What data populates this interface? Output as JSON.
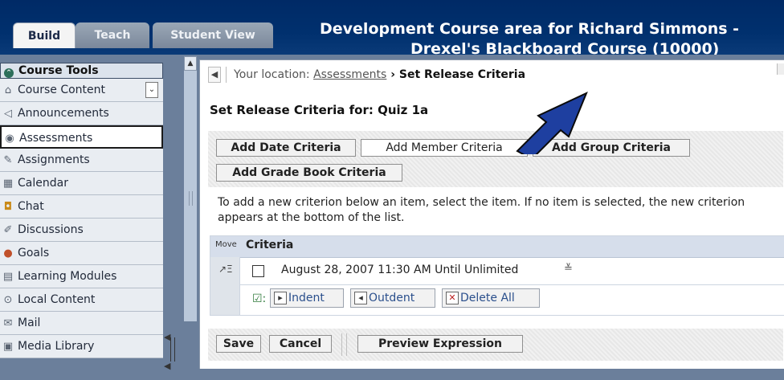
{
  "tabs": [
    {
      "label": "Build",
      "active": true
    },
    {
      "label": "Teach",
      "active": false
    },
    {
      "label": "Student View",
      "active": false
    }
  ],
  "course_title_line1": "Development Course area for Richard Simmons -",
  "course_title_line2": "Drexel's Blackboard Course (10000)",
  "sidebar": {
    "header": "Course Tools",
    "items": [
      {
        "label": "Course Content",
        "icon": "home-icon"
      },
      {
        "label": "Announcements",
        "icon": "megaphone-icon"
      },
      {
        "label": "Assessments",
        "icon": "assessment-icon",
        "active": true
      },
      {
        "label": "Assignments",
        "icon": "assignment-icon"
      },
      {
        "label": "Calendar",
        "icon": "calendar-icon"
      },
      {
        "label": "Chat",
        "icon": "chat-icon"
      },
      {
        "label": "Discussions",
        "icon": "discussion-icon"
      },
      {
        "label": "Goals",
        "icon": "goals-icon"
      },
      {
        "label": "Learning Modules",
        "icon": "learning-modules-icon"
      },
      {
        "label": "Local Content",
        "icon": "local-content-icon"
      },
      {
        "label": "Mail",
        "icon": "mail-icon"
      },
      {
        "label": "Media Library",
        "icon": "media-library-icon"
      }
    ]
  },
  "breadcrumb": {
    "prefix": "Your location: ",
    "link": "Assessments",
    "separator": " › ",
    "current": "Set Release Criteria"
  },
  "page_title": "Set Release Criteria for: Quiz 1a",
  "criteria_buttons": {
    "date": "Add Date Criteria",
    "member": "Add Member Criteria",
    "group": "Add Group Criteria",
    "gradebook": "Add Grade Book Criteria"
  },
  "hint": "To add a new criterion below an item, select the item. If no item is selected, the new criterion appears at the bottom of the list.",
  "criteria_table": {
    "move_header": "Move",
    "criteria_header": "Criteria",
    "rows": [
      {
        "text": "August 28, 2007 11:30 AM Until Unlimited",
        "checked": false
      }
    ],
    "actions": {
      "indent": "Indent",
      "outdent": "Outdent",
      "delete_all": "Delete All"
    }
  },
  "bottom_buttons": {
    "save": "Save",
    "cancel": "Cancel",
    "preview": "Preview Expression"
  },
  "colors": {
    "header_bg": "#002a66",
    "sidebar_bg": "#6b7f9b",
    "annotation_arrow": "#1e3fa0"
  }
}
